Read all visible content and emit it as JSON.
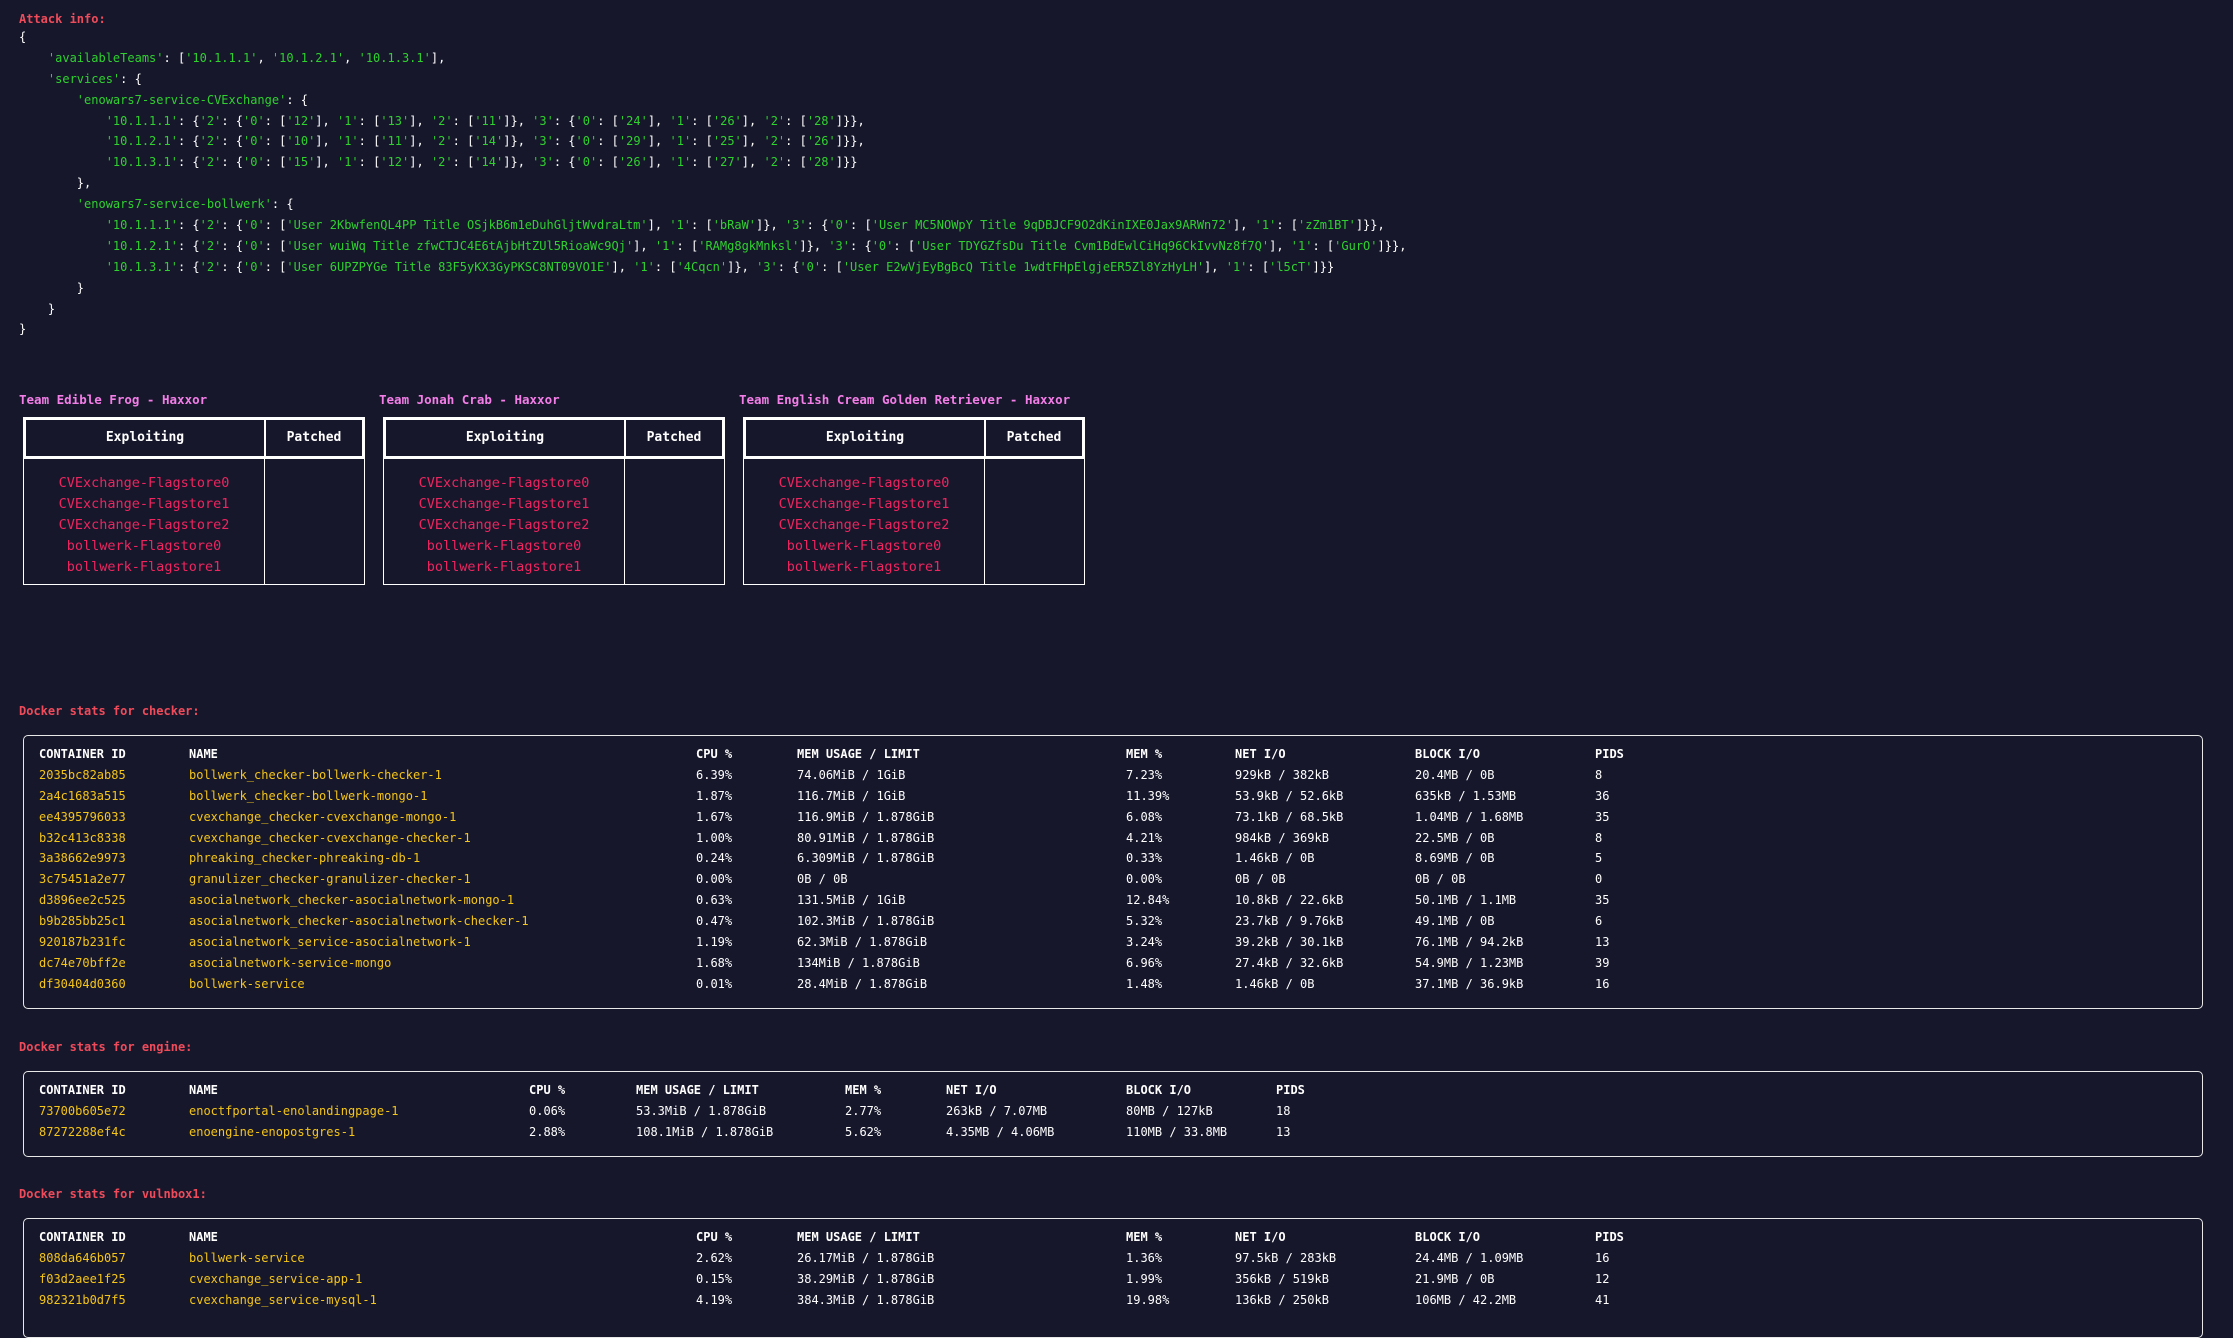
{
  "attack_info": {
    "title": "Attack info:",
    "available_teams": [
      "10.1.1.1",
      "10.1.2.1",
      "10.1.3.1"
    ],
    "services": [
      {
        "name": "enowars7-service-CVExchange",
        "entries": [
          {
            "ip": "10.1.1.1",
            "r2": [
              "12",
              "13",
              "11"
            ],
            "r3": [
              "24",
              "26",
              "28"
            ]
          },
          {
            "ip": "10.1.2.1",
            "r2": [
              "10",
              "11",
              "14"
            ],
            "r3": [
              "29",
              "25",
              "26"
            ]
          },
          {
            "ip": "10.1.3.1",
            "r2": [
              "15",
              "12",
              "14"
            ],
            "r3": [
              "26",
              "27",
              "28"
            ]
          }
        ]
      },
      {
        "name": "enowars7-service-bollwerk",
        "entries": [
          {
            "ip": "10.1.1.1",
            "r2": [
              "User 2KbwfenQL4PP Title OSjkB6m1eDuhGljtWvdraLtm",
              "bRaW"
            ],
            "r3": [
              "User MC5NOWpY Title 9qDBJCF9O2dKinIXE0Jax9ARWn72",
              "zZm1BT"
            ]
          },
          {
            "ip": "10.1.2.1",
            "r2": [
              "User wuiWq Title zfwCTJC4E6tAjbHtZUl5RioaWc9Qj",
              "RAMg8gkMnksl"
            ],
            "r3": [
              "User TDYGZfsDu Title Cvm1BdEwlCiHq96CkIvvNz8f7Q",
              "GurO"
            ]
          },
          {
            "ip": "10.1.3.1",
            "r2": [
              "User 6UPZPYGe Title 83F5yKX3GyPKSC8NT09VO1E",
              "4Cqcn"
            ],
            "r3": [
              "User E2wVjEyBgBcQ Title 1wdtFHpElgjeER5Zl8YzHyLH",
              "l5cT"
            ]
          }
        ]
      }
    ]
  },
  "teams": [
    {
      "title": "Team Edible Frog - Haxxor",
      "col_exploiting": "Exploiting",
      "col_patched": "Patched",
      "exploiting": [
        "CVExchange-Flagstore0",
        "CVExchange-Flagstore1",
        "CVExchange-Flagstore2",
        "bollwerk-Flagstore0",
        "bollwerk-Flagstore1"
      ],
      "patched": []
    },
    {
      "title": "Team Jonah Crab - Haxxor",
      "col_exploiting": "Exploiting",
      "col_patched": "Patched",
      "exploiting": [
        "CVExchange-Flagstore0",
        "CVExchange-Flagstore1",
        "CVExchange-Flagstore2",
        "bollwerk-Flagstore0",
        "bollwerk-Flagstore1"
      ],
      "patched": []
    },
    {
      "title": "Team English Cream Golden Retriever - Haxxor",
      "col_exploiting": "Exploiting",
      "col_patched": "Patched",
      "exploiting": [
        "CVExchange-Flagstore0",
        "CVExchange-Flagstore1",
        "CVExchange-Flagstore2",
        "bollwerk-Flagstore0",
        "bollwerk-Flagstore1"
      ],
      "patched": []
    }
  ],
  "docker": [
    {
      "title": "Docker stats for checker:",
      "headers": [
        "CONTAINER ID",
        "NAME",
        "CPU %",
        "MEM USAGE / LIMIT",
        "MEM %",
        "NET I/O",
        "BLOCK I/O",
        "PIDS"
      ],
      "rows": [
        [
          "2035bc82ab85",
          "bollwerk_checker-bollwerk-checker-1",
          "6.39%",
          "74.06MiB / 1GiB",
          "7.23%",
          "929kB / 382kB",
          "20.4MB / 0B",
          "8"
        ],
        [
          "2a4c1683a515",
          "bollwerk_checker-bollwerk-mongo-1",
          "1.87%",
          "116.7MiB / 1GiB",
          "11.39%",
          "53.9kB / 52.6kB",
          "635kB / 1.53MB",
          "36"
        ],
        [
          "ee4395796033",
          "cvexchange_checker-cvexchange-mongo-1",
          "1.67%",
          "116.9MiB / 1.878GiB",
          "6.08%",
          "73.1kB / 68.5kB",
          "1.04MB / 1.68MB",
          "35"
        ],
        [
          "b32c413c8338",
          "cvexchange_checker-cvexchange-checker-1",
          "1.00%",
          "80.91MiB / 1.878GiB",
          "4.21%",
          "984kB / 369kB",
          "22.5MB / 0B",
          "8"
        ],
        [
          "3a38662e9973",
          "phreaking_checker-phreaking-db-1",
          "0.24%",
          "6.309MiB / 1.878GiB",
          "0.33%",
          "1.46kB / 0B",
          "8.69MB / 0B",
          "5"
        ],
        [
          "3c75451a2e77",
          "granulizer_checker-granulizer-checker-1",
          "0.00%",
          "0B / 0B",
          "0.00%",
          "0B / 0B",
          "0B / 0B",
          "0"
        ],
        [
          "d3896ee2c525",
          "asocialnetwork_checker-asocialnetwork-mongo-1",
          "0.63%",
          "131.5MiB / 1GiB",
          "12.84%",
          "10.8kB / 22.6kB",
          "50.1MB / 1.1MB",
          "35"
        ],
        [
          "b9b285bb25c1",
          "asocialnetwork_checker-asocialnetwork-checker-1",
          "0.47%",
          "102.3MiB / 1.878GiB",
          "5.32%",
          "23.7kB / 9.76kB",
          "49.1MB / 0B",
          "6"
        ],
        [
          "920187b231fc",
          "asocialnetwork_service-asocialnetwork-1",
          "1.19%",
          "62.3MiB / 1.878GiB",
          "3.24%",
          "39.2kB / 30.1kB",
          "76.1MB / 94.2kB",
          "13"
        ],
        [
          "dc74e70bff2e",
          "asocialnetwork-service-mongo",
          "1.68%",
          "134MiB / 1.878GiB",
          "6.96%",
          "27.4kB / 32.6kB",
          "54.9MB / 1.23MB",
          "39"
        ],
        [
          "df30404d0360",
          "bollwerk-service",
          "0.01%",
          "28.4MiB / 1.878GiB",
          "1.48%",
          "1.46kB / 0B",
          "37.1MB / 36.9kB",
          "16"
        ]
      ]
    },
    {
      "title": "Docker stats for engine:",
      "headers": [
        "CONTAINER ID",
        "NAME",
        "CPU %",
        "MEM USAGE / LIMIT",
        "MEM %",
        "NET I/O",
        "BLOCK I/O",
        "PIDS"
      ],
      "rows": [
        [
          "73700b605e72",
          "enoctfportal-enolandingpage-1",
          "0.06%",
          "53.3MiB / 1.878GiB",
          "2.77%",
          "263kB / 7.07MB",
          "80MB / 127kB",
          "18"
        ],
        [
          "87272288ef4c",
          "enoengine-enopostgres-1",
          "2.88%",
          "108.1MiB / 1.878GiB",
          "5.62%",
          "4.35MB / 4.06MB",
          "110MB / 33.8MB",
          "13"
        ]
      ]
    },
    {
      "title": "Docker stats for vulnbox1:",
      "headers": [
        "CONTAINER ID",
        "NAME",
        "CPU %",
        "MEM USAGE / LIMIT",
        "MEM %",
        "NET I/O",
        "BLOCK I/O",
        "PIDS"
      ],
      "rows": [
        [
          "808da646b057",
          "bollwerk-service",
          "2.62%",
          "26.17MiB / 1.878GiB",
          "1.36%",
          "97.5kB / 283kB",
          "24.4MB / 1.09MB",
          "16"
        ],
        [
          "f03d2aee1f25",
          "cvexchange_service-app-1",
          "0.15%",
          "38.29MiB / 1.878GiB",
          "1.99%",
          "356kB / 519kB",
          "21.9MB / 0B",
          "12"
        ],
        [
          "982321b0d7f5",
          "cvexchange_service-mysql-1",
          "4.19%",
          "384.3MiB / 1.878GiB",
          "19.98%",
          "136kB / 250kB",
          "106MB / 42.2MB",
          "41"
        ]
      ]
    }
  ]
}
